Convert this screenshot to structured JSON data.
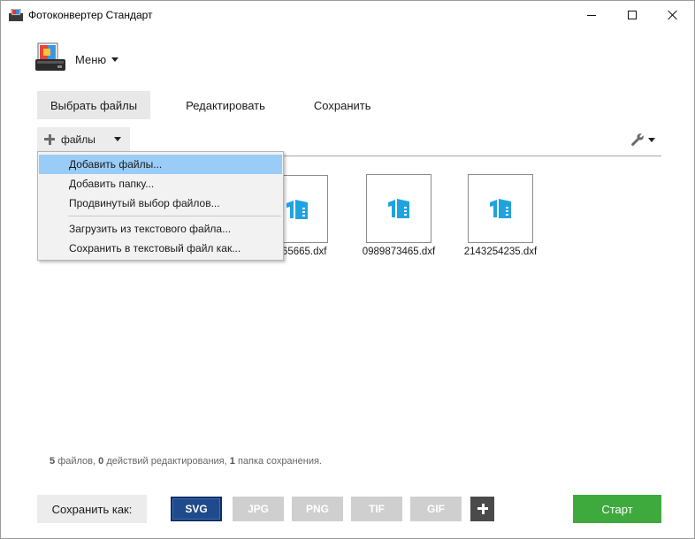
{
  "window": {
    "title": "Фотоконвертер Стандарт"
  },
  "menu": {
    "label": "Меню"
  },
  "tabs": [
    {
      "label": "Выбрать файлы",
      "active": true
    },
    {
      "label": "Редактировать",
      "active": false
    },
    {
      "label": "Сохранить",
      "active": false
    }
  ],
  "toolbar": {
    "files_label": "файлы",
    "settings_icon": "wrench-icon"
  },
  "dropdown": {
    "items": [
      {
        "label": "Добавить файлы...",
        "highlighted": true
      },
      {
        "label": "Добавить папку..."
      },
      {
        "label": "Продвинутый выбор файлов..."
      },
      {
        "label": "Загрузить из текстового файла..."
      },
      {
        "label": "Сохранить в текстовый файл как..."
      }
    ]
  },
  "files": [
    {
      "name": "765665.dxf",
      "icon": "dxf-file-icon"
    },
    {
      "name": "0989873465.dxf",
      "icon": "dxf-file-icon"
    },
    {
      "name": "2143254235.dxf",
      "icon": "dxf-file-icon"
    }
  ],
  "status": {
    "files_count": "5",
    "files_text": "файлов,",
    "edits_count": "0",
    "edits_text": "действий редактирования,",
    "folders_count": "1",
    "folders_text": "папка сохранения."
  },
  "bottom": {
    "save_as_label": "Сохранить как:",
    "formats": [
      {
        "label": "SVG",
        "selected": true
      },
      {
        "label": "JPG",
        "selected": false
      },
      {
        "label": "PNG",
        "selected": false
      },
      {
        "label": "TIF",
        "selected": false
      },
      {
        "label": "GIF",
        "selected": false
      }
    ],
    "start_label": "Старт"
  },
  "colors": {
    "accent_blue": "#1f4a8c",
    "highlight": "#99ccf7",
    "start_green": "#3eaa3e",
    "file_icon": "#1fa3e0"
  }
}
